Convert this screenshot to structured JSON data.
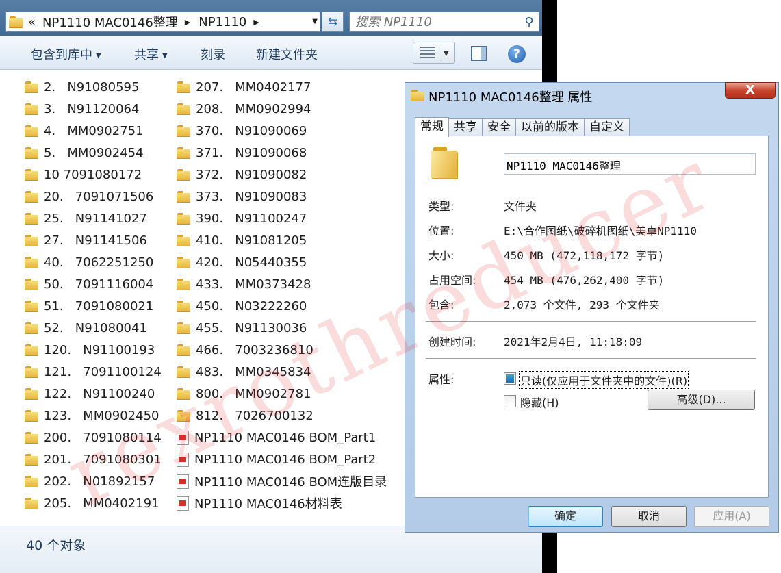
{
  "explorer": {
    "address": {
      "prefix": "«",
      "crumbs": [
        "NP1110 MAC0146整理",
        "NP1110"
      ]
    },
    "search": {
      "placeholder": "搜索 NP1110"
    },
    "toolbar": {
      "include_in_library": "包含到库中",
      "share": "共享",
      "burn": "刻录",
      "new_folder": "新建文件夹"
    },
    "column1": [
      {
        "type": "folder",
        "name": "2.   N91080595"
      },
      {
        "type": "folder",
        "name": "3.   N91120064"
      },
      {
        "type": "folder",
        "name": "4.   MM0902751"
      },
      {
        "type": "folder",
        "name": "5.   MM0902454"
      },
      {
        "type": "folder",
        "name": "10 7091080172"
      },
      {
        "type": "folder",
        "name": "20.   7091071506"
      },
      {
        "type": "folder",
        "name": "25.   N91141027"
      },
      {
        "type": "folder",
        "name": "27.   N91141506"
      },
      {
        "type": "folder",
        "name": "40.   7062251250"
      },
      {
        "type": "folder",
        "name": "50.   7091116004"
      },
      {
        "type": "folder",
        "name": "51.   7091080021"
      },
      {
        "type": "folder",
        "name": "52.   N91080041"
      },
      {
        "type": "folder",
        "name": "120.   N91100193"
      },
      {
        "type": "folder",
        "name": "121.   7091100124"
      },
      {
        "type": "folder",
        "name": "122.   N91100240"
      },
      {
        "type": "folder",
        "name": "123.   MM0902450"
      },
      {
        "type": "folder",
        "name": "200.   7091080114"
      },
      {
        "type": "folder",
        "name": "201.   7091080301"
      },
      {
        "type": "folder",
        "name": "202.   N01892157"
      },
      {
        "type": "folder",
        "name": "205.   MM0402191"
      }
    ],
    "column2": [
      {
        "type": "folder",
        "name": "207.   MM0402177"
      },
      {
        "type": "folder",
        "name": "208.   MM0902994"
      },
      {
        "type": "folder",
        "name": "370.   N91090069"
      },
      {
        "type": "folder",
        "name": "371.   N91090068"
      },
      {
        "type": "folder",
        "name": "372.   N91090082"
      },
      {
        "type": "folder",
        "name": "373.   N91090083"
      },
      {
        "type": "folder",
        "name": "390.   N91100247"
      },
      {
        "type": "folder",
        "name": "410.   N91081205"
      },
      {
        "type": "folder",
        "name": "420.   N05440355"
      },
      {
        "type": "folder",
        "name": "433.   MM0373428"
      },
      {
        "type": "folder",
        "name": "450.   N03222260"
      },
      {
        "type": "folder",
        "name": "455.   N91130036"
      },
      {
        "type": "folder",
        "name": "466.   7003236810"
      },
      {
        "type": "folder",
        "name": "483.   MM0345834"
      },
      {
        "type": "folder",
        "name": "800.   MM0902781"
      },
      {
        "type": "folder",
        "name": "812.   7026700132"
      },
      {
        "type": "pdf",
        "name": "NP1110 MAC0146 BOM_Part1"
      },
      {
        "type": "pdf",
        "name": "NP1110 MAC0146 BOM_Part2"
      },
      {
        "type": "pdf",
        "name": "NP1110 MAC0146 BOM连版目录"
      },
      {
        "type": "pdf",
        "name": "NP1110 MAC0146材料表"
      }
    ],
    "status": "40 个对象"
  },
  "dialog": {
    "title": "NP1110 MAC0146整理 属性",
    "close_label": "X",
    "tabs": [
      "常规",
      "共享",
      "安全",
      "以前的版本",
      "自定义"
    ],
    "name_value": "NP1110 MAC0146整理",
    "properties": {
      "type_label": "类型:",
      "type_value": "文件夹",
      "location_label": "位置:",
      "location_value": "E:\\合作图纸\\破碎机图纸\\美卓NP1110",
      "size_label": "大小:",
      "size_value": "450 MB (472,118,172 字节)",
      "disk_label": "占用空间:",
      "disk_value": "454 MB (476,262,400 字节)",
      "contains_label": "包含:",
      "contains_value": "2,073 个文件, 293 个文件夹",
      "created_label": "创建时间:",
      "created_value": "2021年2月4日, 11:18:09",
      "attributes_label": "属性:"
    },
    "readonly_label": "只读(仅应用于文件夹中的文件)(R)",
    "hidden_label": "隐藏(H)",
    "advanced_label": "高级(D)...",
    "ok_label": "确定",
    "cancel_label": "取消",
    "apply_label": "应用(A)"
  },
  "watermark": "rexrothreducer",
  "colors": {
    "titlebar": "#3f6b95",
    "dialog_frame": "#b3cbe7",
    "close_button": "#c9462e",
    "watermark": "#e12828"
  }
}
